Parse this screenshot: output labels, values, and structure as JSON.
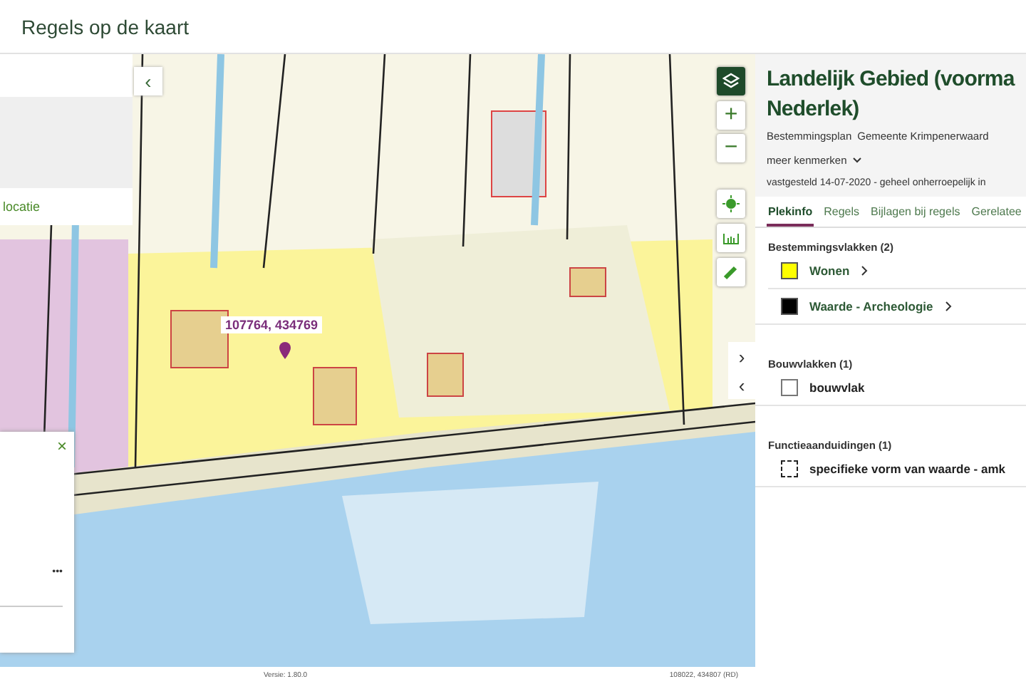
{
  "header": {
    "title": "Regels op de kaart"
  },
  "map": {
    "kind": "picture",
    "coordinate_label": "107764, 434769",
    "left_panel": {
      "link": "locatie"
    },
    "bottom_panel": {
      "more": "•••",
      "close": "×"
    },
    "chevron_right": "›",
    "chevron_left": "‹",
    "collapse": "‹",
    "zoom_in": "+",
    "zoom_out": "−",
    "version": "Versie: 1.80.0",
    "coordinates": "108022, 434807 (RD)"
  },
  "plan": {
    "title_lines": [
      "Landelijk Gebied (voorma",
      "Nederlek)"
    ],
    "type": "Bestemmingsplan",
    "owner": "Gemeente Krimpenerwaard",
    "more": "meer kenmerken",
    "status": "vastgesteld 14-07-2020 - geheel onherroepelijk in"
  },
  "tabs": [
    {
      "label": "Plekinfo",
      "selected": true
    },
    {
      "label": "Regels",
      "selected": false
    },
    {
      "label": "Bijlagen bij regels",
      "selected": false
    },
    {
      "label": "Gerelatee",
      "selected": false
    }
  ],
  "sections": [
    {
      "title": "Bestemmingsvlakken (2)",
      "items": [
        {
          "label": "Wonen",
          "kind": "fill",
          "color": "#ffff00",
          "link": true
        },
        {
          "label": "Waarde - Archeologie",
          "kind": "fill",
          "color": "#000000",
          "link": true
        }
      ]
    },
    {
      "title": "Bouwvlakken (1)",
      "items": [
        {
          "label": "bouwvlak",
          "kind": "outline",
          "link": false
        }
      ]
    },
    {
      "title": "Functieaanduidingen (1)",
      "items": [
        {
          "label": "specifieke vorm van waarde - amk",
          "kind": "dashed",
          "link": false
        }
      ]
    }
  ]
}
